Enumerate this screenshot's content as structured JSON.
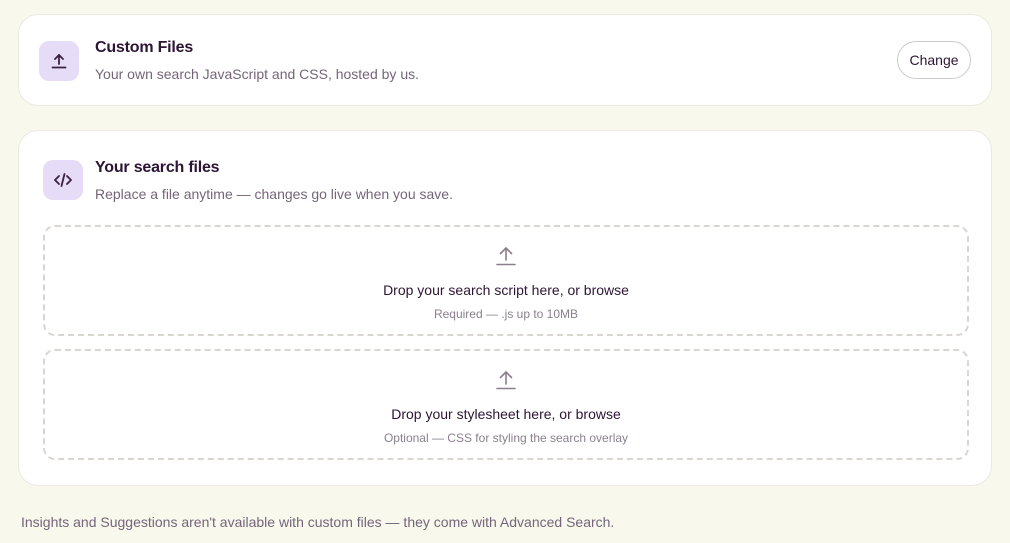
{
  "header_card": {
    "icon": "upload-icon",
    "title": "Custom Files",
    "subtitle": "Your own search JavaScript and CSS, hosted by us.",
    "change_label": "Change"
  },
  "files_card": {
    "icon": "code-icon",
    "title": "Your search files",
    "subtitle": "Replace a file anytime — changes go live when you save.",
    "dropzones": [
      {
        "icon": "upload-icon",
        "label": "Drop your search script here, or browse",
        "hint": "Required — .js up to 10MB"
      },
      {
        "icon": "upload-icon",
        "label": "Drop your stylesheet here, or browse",
        "hint": "Optional — CSS for styling the search overlay"
      }
    ]
  },
  "footnote": "Insights and Suggestions aren't available with custom files — they come with Advanced Search.",
  "colors": {
    "background": "#f8f8ed",
    "icon_tile": "#e6dcf7",
    "heading": "#2d1534",
    "muted_text": "#75657a"
  }
}
